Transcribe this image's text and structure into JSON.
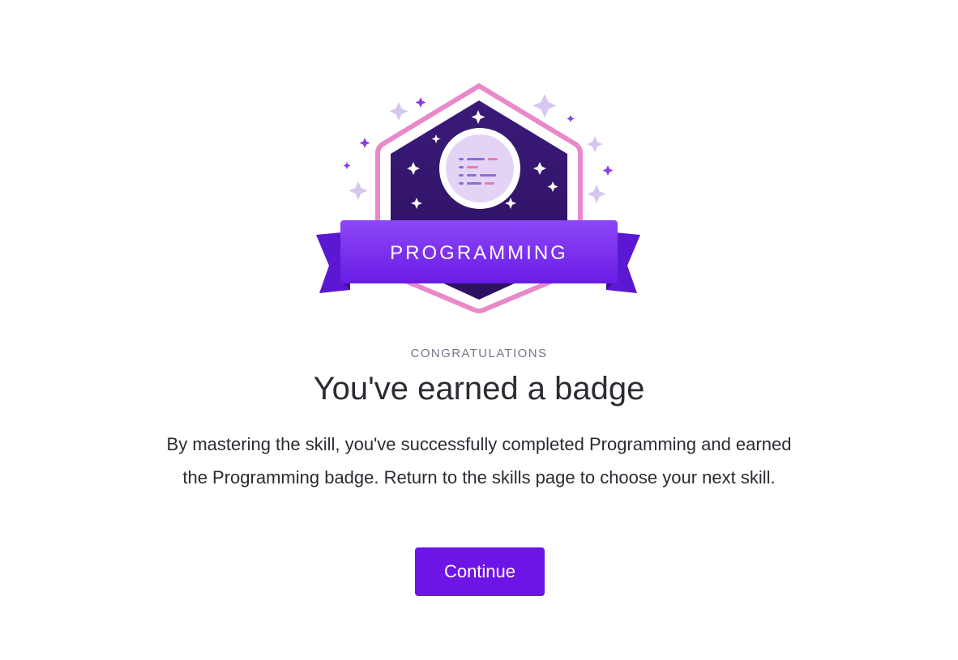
{
  "badge": {
    "ribbon_label": "PROGRAMMING",
    "icon": "code-lines-icon",
    "colors": {
      "frame": "#e889c9",
      "hexagon": "#3a1877",
      "ribbon": "#7b2ff0",
      "ribbon_tail": "#5b17d1",
      "medallion": "#e3d4f5"
    }
  },
  "eyebrow": "CONGRATULATIONS",
  "title": "You've earned a badge",
  "body": "By mastering the skill, you've successfully completed Programming and earned the Programming badge. Return to the skills page to choose your next skill.",
  "continue_label": "Continue",
  "colors": {
    "accent": "#6d14e6",
    "text": "#2d2a32",
    "muted": "#7a7386"
  }
}
